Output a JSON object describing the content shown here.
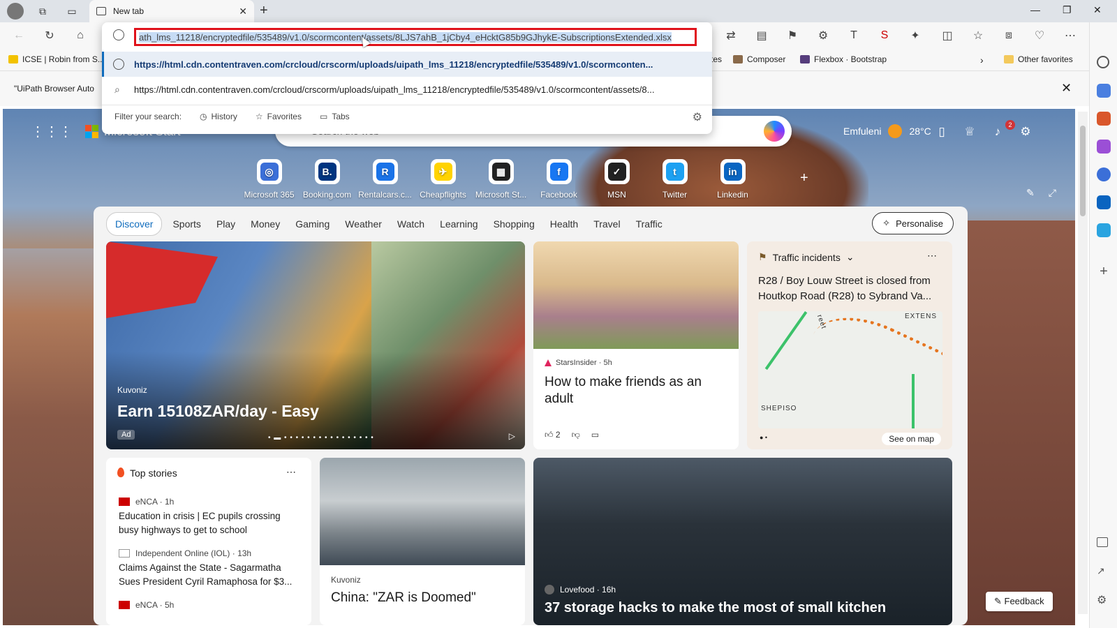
{
  "tab": {
    "title": "New tab"
  },
  "omnibox": {
    "url_value": "ath_lms_11218/encryptedfile/535489/v1.0/scormcontent/assets/8LJS7ahB_1jCby4_eHcktG85b9GJhykE-SubscriptionsExtended.xlsx",
    "suggestion_1": "https://html.cdn.contentraven.com/crcloud/crscorm/uploads/uipath_lms_11218/encryptedfile/535489/v1.0/scormconten...",
    "suggestion_2": "https://html.cdn.contentraven.com/crcloud/crscorm/uploads/uipath_lms_11218/encryptedfile/535489/v1.0/scormcontent/assets/8...",
    "filter_label": "Filter your search:",
    "filter_history": "History",
    "filter_favorites": "Favorites",
    "filter_tabs": "Tabs"
  },
  "bookmarks": {
    "items": [
      "ICSE | Robin from S...",
      "tes",
      "Composer",
      "Flexbox · Bootstrap"
    ],
    "other": "Other favorites"
  },
  "findbar": {
    "text": "\"UiPath Browser Auto"
  },
  "header": {
    "brand": "Microsoft Start",
    "search_placeholder": "Search the web",
    "location": "Emfuleni",
    "temperature": "28°C",
    "notif_count": "2"
  },
  "quick_links": [
    {
      "label": "Microsoft 365",
      "color": "#3b6fd8",
      "glyph": "◎"
    },
    {
      "label": "Booking.com",
      "color": "#003580",
      "glyph": "B."
    },
    {
      "label": "Rentalcars.c...",
      "color": "#1a73e8",
      "glyph": "R"
    },
    {
      "label": "Cheapflights",
      "color": "#ffd300",
      "glyph": "✈"
    },
    {
      "label": "Microsoft St...",
      "color": "#222222",
      "glyph": "▦"
    },
    {
      "label": "Facebook",
      "color": "#1877f2",
      "glyph": "f"
    },
    {
      "label": "MSN",
      "color": "#222222",
      "glyph": "✓"
    },
    {
      "label": "Twitter",
      "color": "#1da1f2",
      "glyph": "t"
    },
    {
      "label": "Linkedin",
      "color": "#0a66c2",
      "glyph": "in"
    }
  ],
  "nav": {
    "tabs": [
      "Discover",
      "Sports",
      "Play",
      "Money",
      "Gaming",
      "Weather",
      "Watch",
      "Learning",
      "Shopping",
      "Health",
      "Travel",
      "Traffic"
    ],
    "personalise": "Personalise"
  },
  "hero": {
    "source": "Kuvoniz",
    "title": "Earn 15108ZAR/day - Easy",
    "ad": "Ad"
  },
  "friends": {
    "source": "StarsInsider · 5h",
    "title": "How to make friends as an adult",
    "likes": "2"
  },
  "traffic": {
    "header": "Traffic incidents",
    "title": "R28 / Boy Louw Street is closed from Houtkop Road (R28) to Sybrand Va...",
    "map_label_1": "EXTENS",
    "map_label_2": "SHEPISO",
    "map_label_3": "reet",
    "see_map": "See on map"
  },
  "top_stories": {
    "header": "Top stories",
    "items": [
      {
        "source": "eNCA · 1h",
        "title": "Education in crisis | EC pupils crossing busy highways to get to school"
      },
      {
        "source": "Independent Online (IOL) · 13h",
        "title": "Claims Against the State - Sagarmatha Sues President Cyril Ramaphosa for $3..."
      },
      {
        "source": "eNCA · 5h",
        "title": ""
      }
    ]
  },
  "china": {
    "source": "Kuvoniz",
    "title": "China: \"ZAR is Doomed\""
  },
  "kitchen": {
    "source": "Lovefood · 16h",
    "title": "37 storage hacks to make the most of small kitchen"
  },
  "feedback": "Feedback"
}
